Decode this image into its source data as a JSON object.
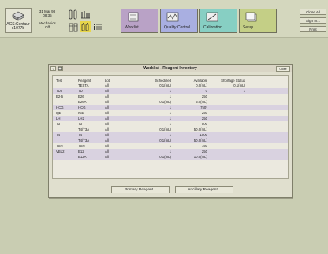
{
  "system": {
    "name_line1": "ACS:Centaur",
    "name_line2": "c1077b"
  },
  "status": {
    "date": "31 Mar 98",
    "time": "08:35",
    "operator_line1": "Mechanics",
    "operator_line2": "Off"
  },
  "nav": [
    {
      "label": "Worklist",
      "color": "#b9a2c6"
    },
    {
      "label": "Quality Control",
      "color": "#a9afe1"
    },
    {
      "label": "Calibration",
      "color": "#87cfc3"
    },
    {
      "label": "Setup",
      "color": "#c4cf86"
    }
  ],
  "right_buttons": {
    "close_all": "Close All",
    "sign_in": "Sign In...",
    "print": "Print"
  },
  "dialog": {
    "question": "?",
    "title": "Worklist - Reagent Inventory",
    "close": "Close",
    "columns": [
      "Test",
      "Reagent",
      "Lot",
      "Scheduled",
      "Available",
      "Shortage Status"
    ],
    "rows": [
      [
        "",
        "TESTA",
        "All",
        "0.1(mL)",
        "0.0(mL)",
        "0.1(mL)"
      ],
      [
        "TUp",
        "TU",
        "All",
        "1",
        "0",
        "1"
      ],
      [
        "E2-6",
        "E26",
        "All",
        "1",
        "250",
        ""
      ],
      [
        "",
        "E26A",
        "All",
        "0.1(mL)",
        "5.0(mL)",
        ""
      ],
      [
        "HCG",
        "HCG",
        "All",
        "1",
        "750*",
        ""
      ],
      [
        "IgE",
        "IGE",
        "All",
        "1",
        "250",
        ""
      ],
      [
        "LH",
        "LH2",
        "All",
        "1",
        "250",
        ""
      ],
      [
        "T3",
        "T3",
        "All",
        "1",
        "500",
        ""
      ],
      [
        "",
        "T4/T3A",
        "All",
        "0.1(mL)",
        "50.0(mL)",
        ""
      ],
      [
        "T4",
        "T4",
        "All",
        "1",
        "1000",
        ""
      ],
      [
        "",
        "T4/T3A",
        "All",
        "0.1(mL)",
        "50.0(mL)",
        ""
      ],
      [
        "TSH",
        "TSH",
        "All",
        "1",
        "750",
        ""
      ],
      [
        "VB12",
        "B12",
        "All",
        "1",
        "250",
        ""
      ],
      [
        "",
        "B12A",
        "All",
        "0.1(mL)",
        "10.0(mL)",
        ""
      ]
    ],
    "primary_button": "Primary Reagent...",
    "ancillary_button": "Ancillary Reagent..."
  }
}
